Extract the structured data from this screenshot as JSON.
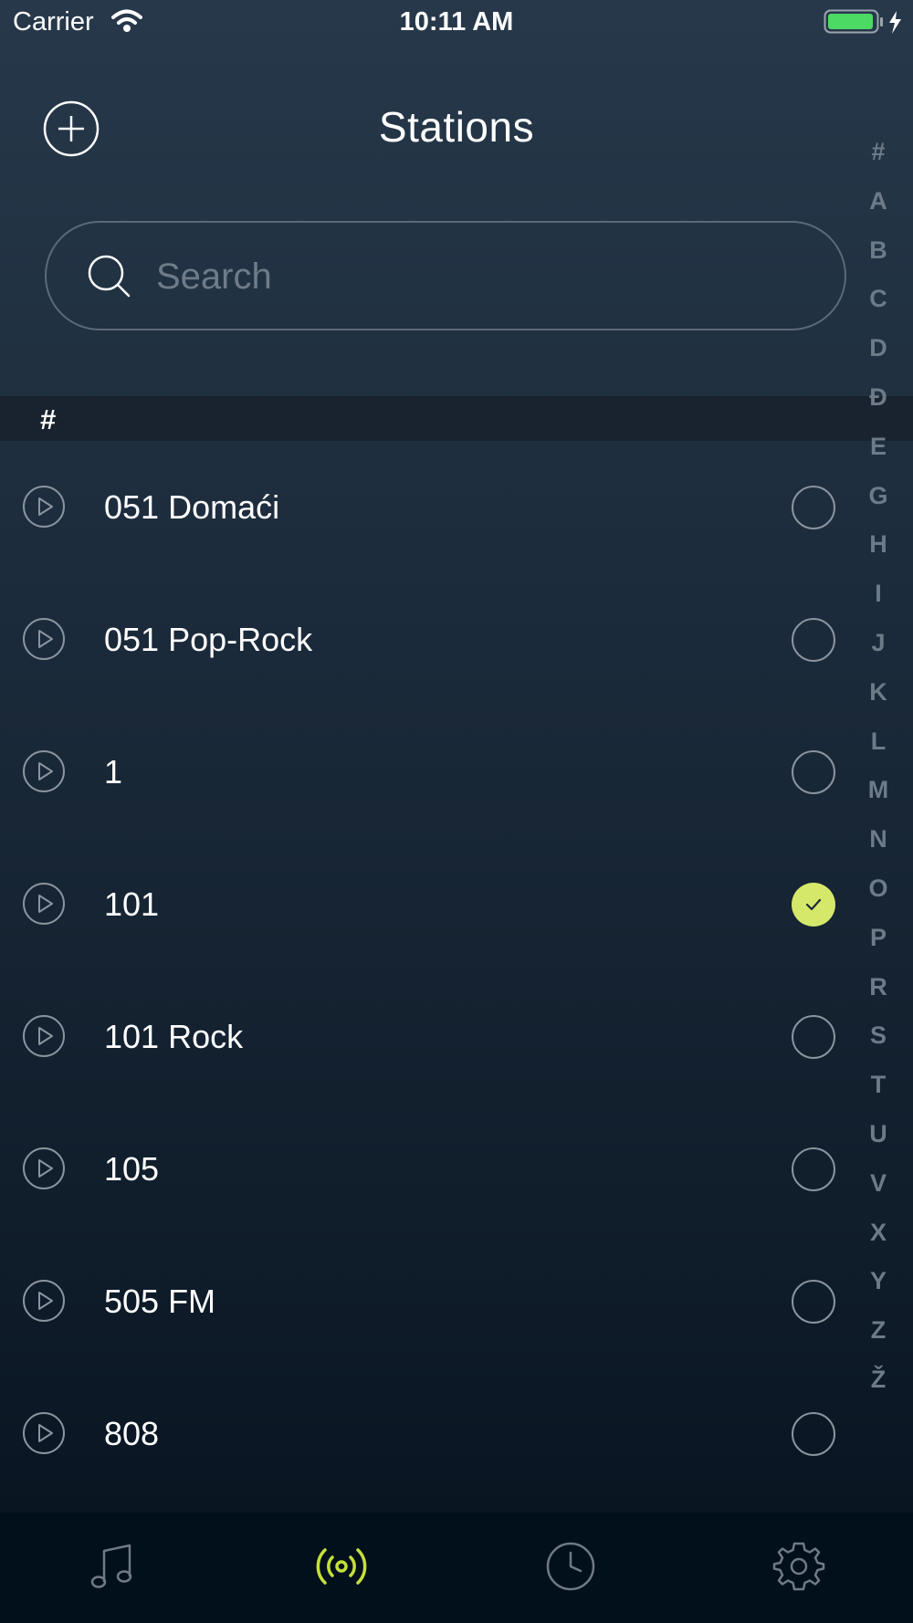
{
  "status_bar": {
    "carrier": "Carrier",
    "time": "10:11 AM"
  },
  "header": {
    "title": "Stations"
  },
  "search": {
    "placeholder": "Search"
  },
  "section": {
    "header": "#"
  },
  "stations": [
    {
      "name": "051 Domaći",
      "selected": false
    },
    {
      "name": "051 Pop-Rock",
      "selected": false
    },
    {
      "name": "1",
      "selected": false
    },
    {
      "name": "101",
      "selected": true
    },
    {
      "name": "101 Rock",
      "selected": false
    },
    {
      "name": "105",
      "selected": false
    },
    {
      "name": "505 FM",
      "selected": false
    },
    {
      "name": "808",
      "selected": false
    }
  ],
  "index_letters": [
    "#",
    "A",
    "B",
    "C",
    "D",
    "Đ",
    "E",
    "G",
    "H",
    "I",
    "J",
    "K",
    "L",
    "M",
    "N",
    "O",
    "P",
    "R",
    "S",
    "T",
    "U",
    "V",
    "X",
    "Y",
    "Z",
    "Ž"
  ],
  "tab_bar": {
    "tabs": [
      "music-note-icon",
      "radio-broadcast-icon",
      "clock-icon",
      "gear-icon"
    ],
    "active": "radio-broadcast-icon"
  },
  "colors": {
    "accent": "#d6e86a",
    "tab_inactive": "#6f7a85",
    "tab_active": "#c5e03a"
  }
}
